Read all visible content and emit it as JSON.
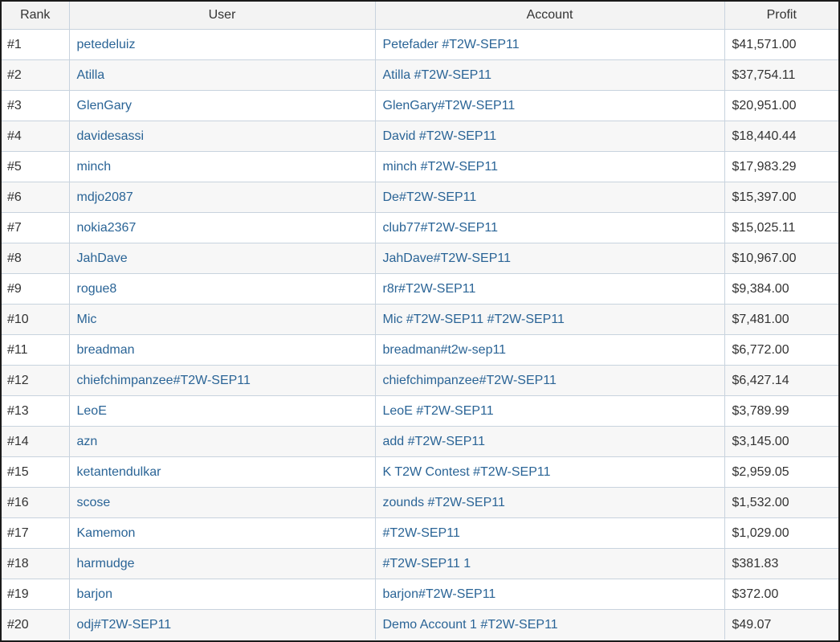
{
  "headers": {
    "rank": "Rank",
    "user": "User",
    "account": "Account",
    "profit": "Profit"
  },
  "colors": {
    "link": "#2a6496",
    "header_bg": "#f3f3f3",
    "border": "#c8d3de",
    "stripe": "#f7f7f7"
  },
  "rows": [
    {
      "rank": "#1",
      "user": "petedeluiz",
      "account": "Petefader #T2W-SEP11",
      "profit": "$41,571.00"
    },
    {
      "rank": "#2",
      "user": "Atilla",
      "account": "Atilla #T2W-SEP11",
      "profit": "$37,754.11"
    },
    {
      "rank": "#3",
      "user": "GlenGary",
      "account": "GlenGary#T2W-SEP11",
      "profit": "$20,951.00"
    },
    {
      "rank": "#4",
      "user": "davidesassi",
      "account": "David #T2W-SEP11",
      "profit": "$18,440.44"
    },
    {
      "rank": "#5",
      "user": "minch",
      "account": "minch #T2W-SEP11",
      "profit": "$17,983.29"
    },
    {
      "rank": "#6",
      "user": "mdjo2087",
      "account": "De#T2W-SEP11",
      "profit": "$15,397.00"
    },
    {
      "rank": "#7",
      "user": "nokia2367",
      "account": "club77#T2W-SEP11",
      "profit": "$15,025.11"
    },
    {
      "rank": "#8",
      "user": "JahDave",
      "account": "JahDave#T2W-SEP11",
      "profit": "$10,967.00"
    },
    {
      "rank": "#9",
      "user": "rogue8",
      "account": "r8r#T2W-SEP11",
      "profit": "$9,384.00"
    },
    {
      "rank": "#10",
      "user": "Mic",
      "account": "Mic #T2W-SEP11 #T2W-SEP11",
      "profit": "$7,481.00"
    },
    {
      "rank": "#11",
      "user": "breadman",
      "account": "breadman#t2w-sep11",
      "profit": "$6,772.00"
    },
    {
      "rank": "#12",
      "user": "chiefchimpanzee#T2W-SEP11",
      "account": "chiefchimpanzee#T2W-SEP11",
      "profit": "$6,427.14"
    },
    {
      "rank": "#13",
      "user": "LeoE",
      "account": "LeoE #T2W-SEP11",
      "profit": "$3,789.99"
    },
    {
      "rank": "#14",
      "user": "azn",
      "account": "add #T2W-SEP11",
      "profit": "$3,145.00"
    },
    {
      "rank": "#15",
      "user": "ketantendulkar",
      "account": "K T2W Contest #T2W-SEP11",
      "profit": "$2,959.05"
    },
    {
      "rank": "#16",
      "user": "scose",
      "account": "zounds #T2W-SEP11",
      "profit": "$1,532.00"
    },
    {
      "rank": "#17",
      "user": "Kamemon",
      "account": "#T2W-SEP11",
      "profit": "$1,029.00"
    },
    {
      "rank": "#18",
      "user": "harmudge",
      "account": "#T2W-SEP11 1",
      "profit": "$381.83"
    },
    {
      "rank": "#19",
      "user": "barjon",
      "account": "barjon#T2W-SEP11",
      "profit": "$372.00"
    },
    {
      "rank": "#20",
      "user": "odj#T2W-SEP11",
      "account": "Demo Account 1 #T2W-SEP11",
      "profit": "$49.07"
    }
  ]
}
